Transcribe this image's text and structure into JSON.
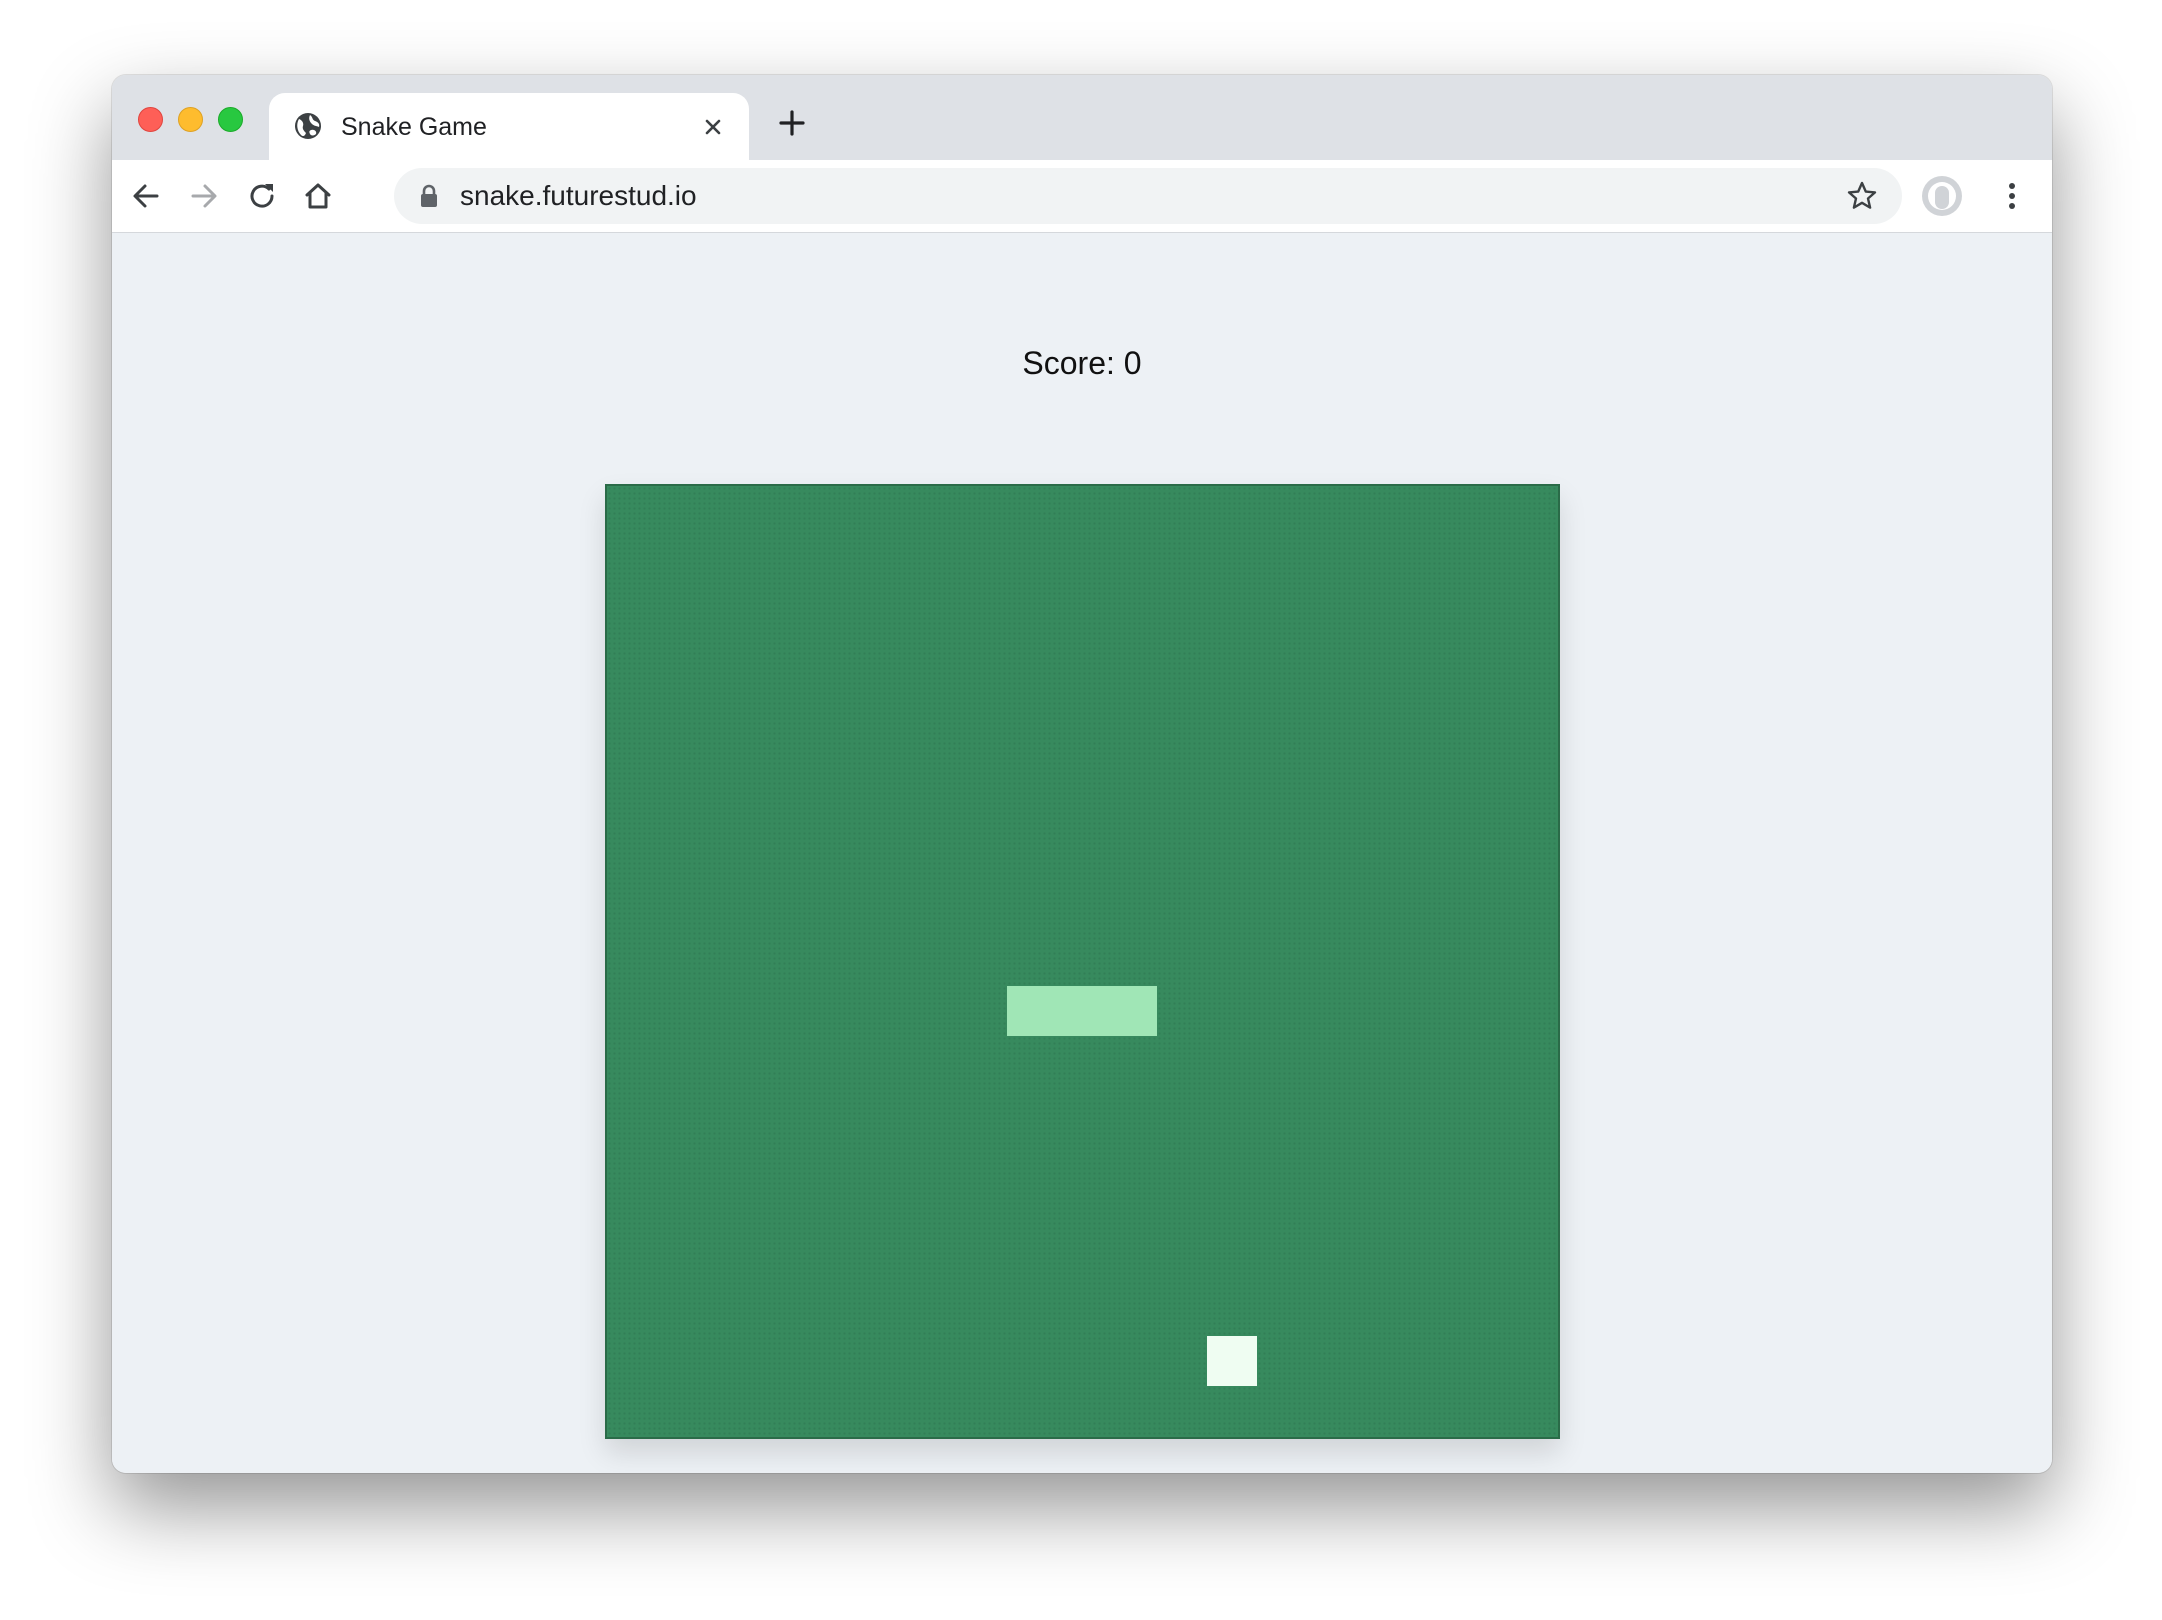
{
  "browser": {
    "tab": {
      "title": "Snake Game",
      "icon": "globe-icon"
    },
    "address_bar": {
      "url": "snake.futurestud.io",
      "secure": true
    },
    "icons": {
      "back": "arrow-left-icon",
      "forward": "arrow-right-icon",
      "reload": "reload-icon",
      "home": "home-icon",
      "bookmark": "star-icon",
      "profile": "avatar",
      "menu": "kebab-menu-icon",
      "new_tab": "plus-icon",
      "close_tab": "close-icon"
    }
  },
  "game": {
    "score_label": "Score:",
    "score": "0",
    "colors": {
      "board": "#378a5e",
      "snake": "#a0e6b6",
      "food": "#effdf2",
      "page_background": "#edf1f5"
    }
  }
}
